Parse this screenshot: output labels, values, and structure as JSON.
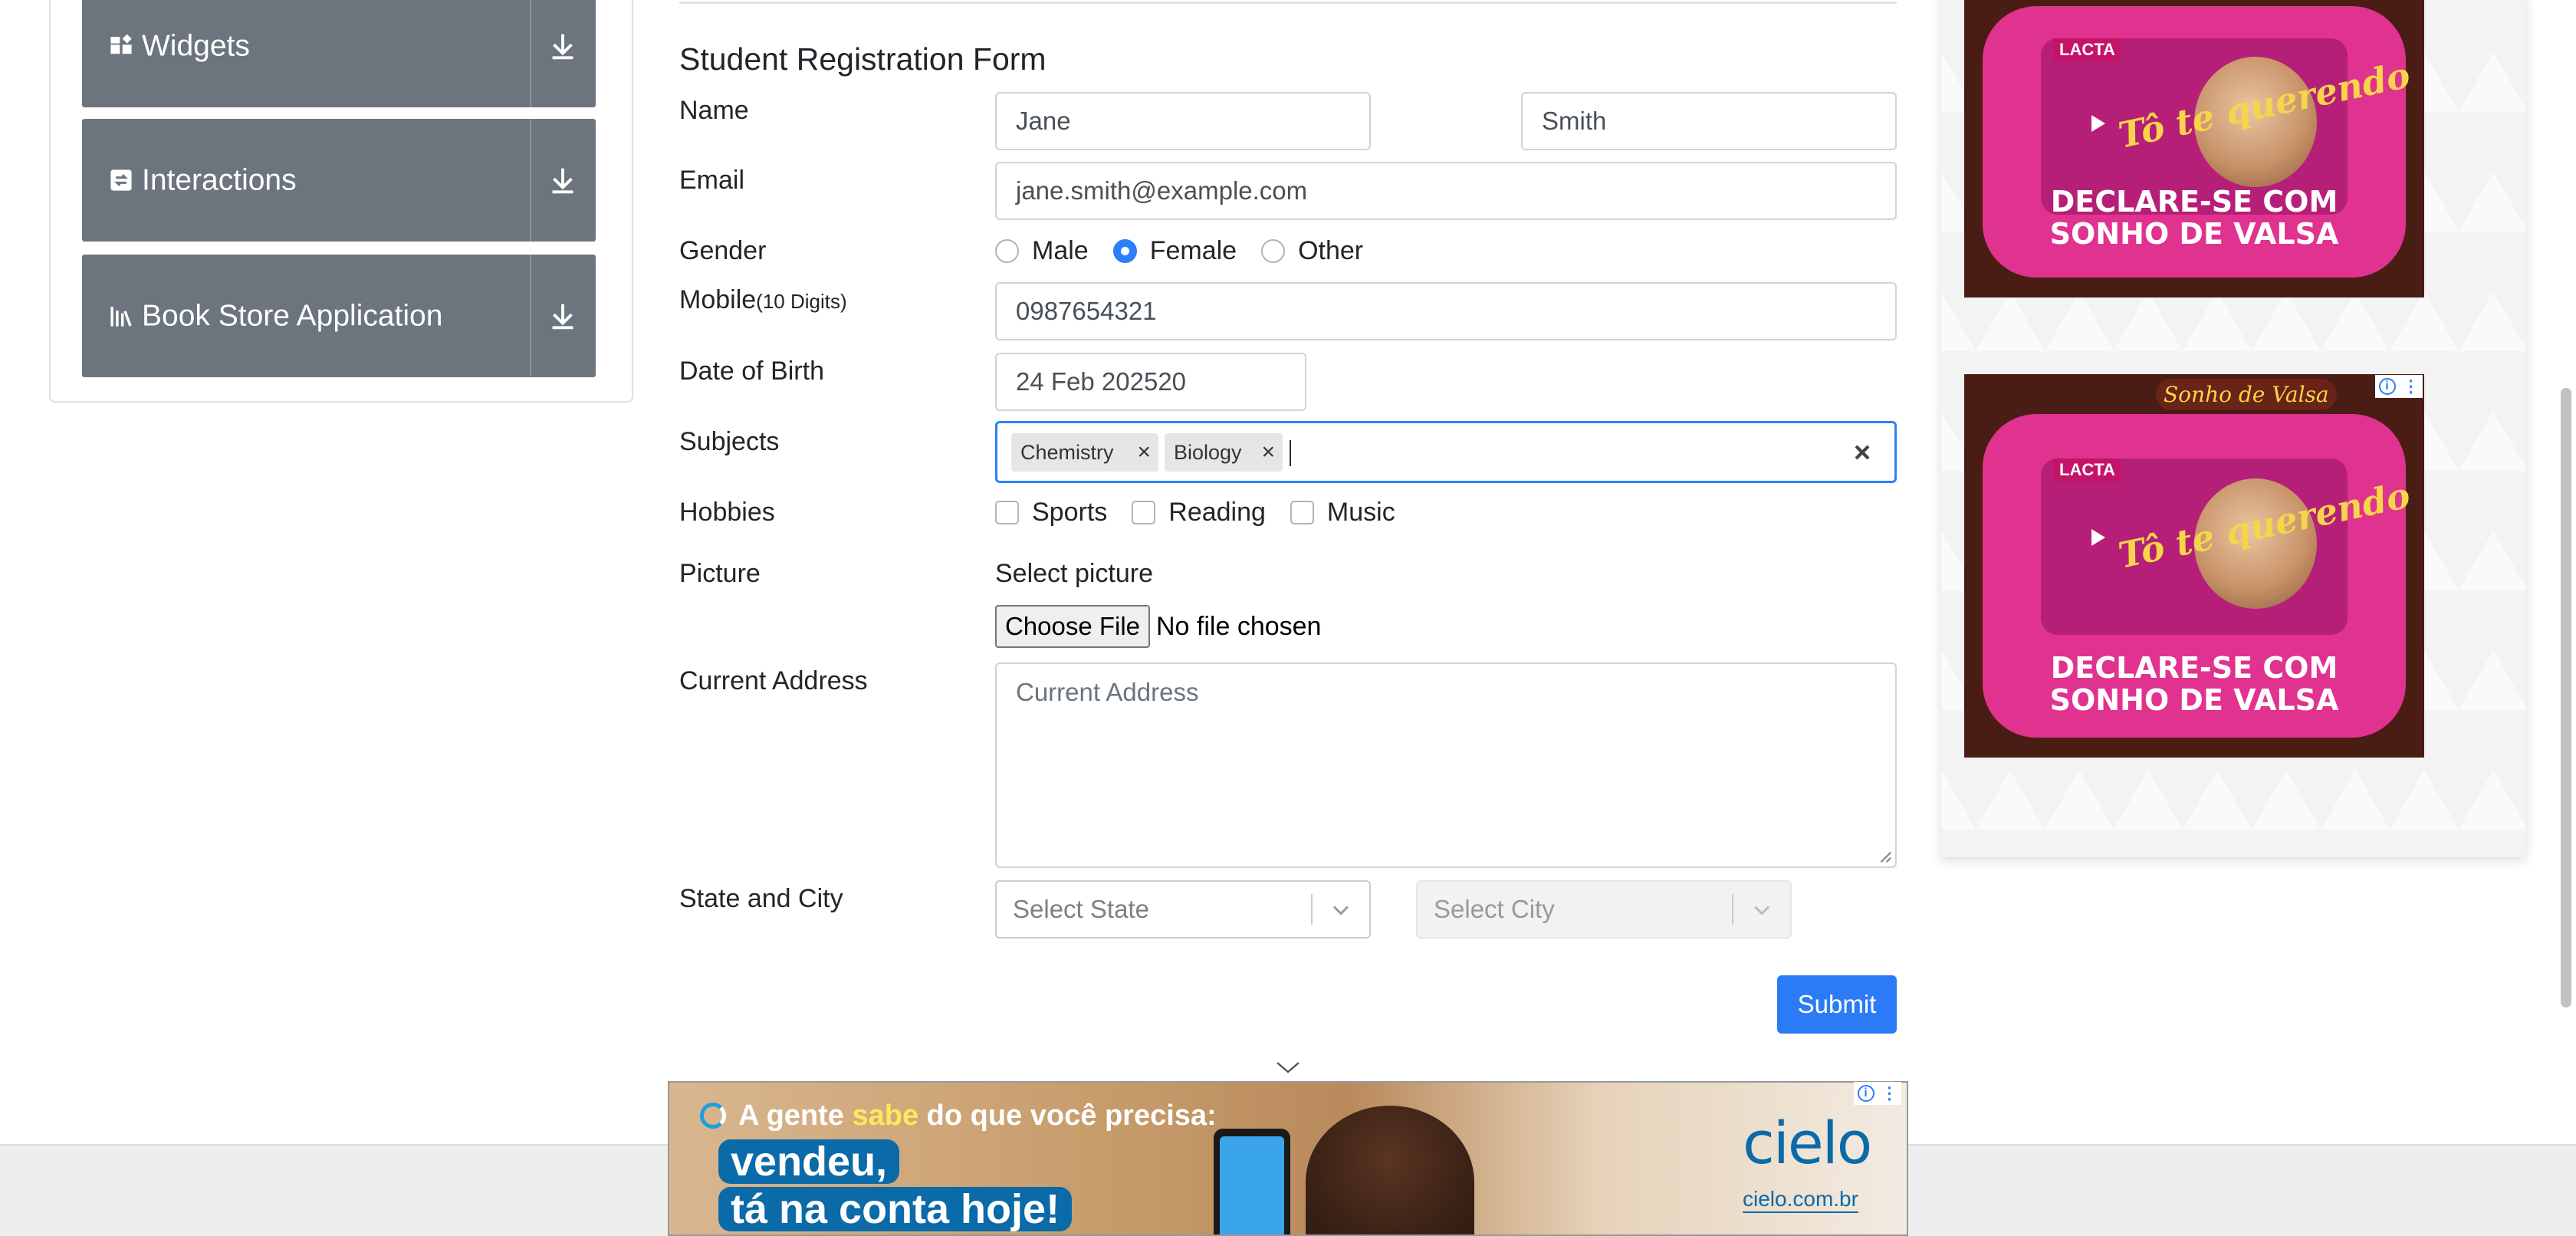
{
  "sidebar": {
    "groups": [
      {
        "label": "Widgets",
        "icon": "widgets-icon"
      },
      {
        "label": "Interactions",
        "icon": "interactions-icon"
      },
      {
        "label": "Book Store Application",
        "icon": "book-store-icon"
      }
    ]
  },
  "form": {
    "title": "Student Registration Form",
    "name": {
      "label": "Name",
      "first": "Jane",
      "last": "Smith"
    },
    "email": {
      "label": "Email",
      "value": "jane.smith@example.com"
    },
    "gender": {
      "label": "Gender",
      "options": [
        "Male",
        "Female",
        "Other"
      ],
      "selected": "Female"
    },
    "mobile": {
      "label": "Mobile",
      "hint": "(10 Digits)",
      "value": "0987654321"
    },
    "dob": {
      "label": "Date of Birth",
      "value": "24 Feb 202520"
    },
    "subjects": {
      "label": "Subjects",
      "chips": [
        "Chemistry",
        "Biology"
      ],
      "remove_glyph": "×",
      "clear_icon": "clear-x-icon"
    },
    "hobbies": {
      "label": "Hobbies",
      "options": [
        "Sports",
        "Reading",
        "Music"
      ],
      "checked": []
    },
    "picture": {
      "label": "Picture",
      "select_text": "Select picture",
      "button": "Choose File",
      "status": "No file chosen"
    },
    "address": {
      "label": "Current Address",
      "placeholder": "Current Address"
    },
    "state_city": {
      "label": "State and City",
      "state_placeholder": "Select State",
      "city_placeholder": "Select City"
    },
    "submit": "Submit"
  },
  "ads": {
    "candy": {
      "brand": "Sonho de Valsa",
      "maker": "LACTA",
      "tagline": "Tô te querendo",
      "line1": "DECLARE-SE COM",
      "line2": "SONHO DE VALSA"
    },
    "bottom": {
      "tagline_pre": "A gente ",
      "tagline_bold": "sabe",
      "tagline_post": " do que você precisa:",
      "headline1": "vendeu,",
      "headline2": "tá na conta hoje!",
      "logo": "cielo",
      "url": "cielo.com.br"
    },
    "badge_info": "i",
    "badge_menu": "⋮"
  },
  "colors": {
    "sidebar_header": "#6c757d",
    "accent": "#2d7ff9",
    "submit": "#2b7bf6",
    "candy_pink": "#e0338f"
  }
}
